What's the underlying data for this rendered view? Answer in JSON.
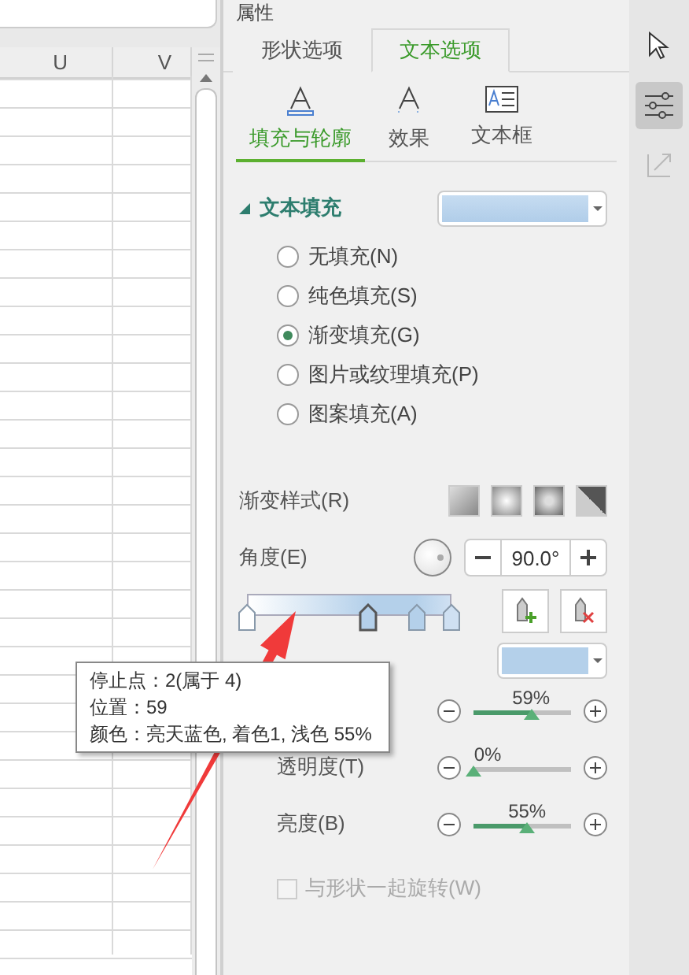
{
  "spreadsheet": {
    "columns": [
      "U",
      "V"
    ]
  },
  "panel": {
    "title": "属性",
    "tabs": [
      {
        "label": "形状选项",
        "selected": false
      },
      {
        "label": "文本选项",
        "selected": true
      }
    ],
    "subtabs": [
      {
        "kind": "fill",
        "label": "填充与轮廓",
        "selected": true
      },
      {
        "kind": "effect",
        "label": "效果",
        "selected": false
      },
      {
        "kind": "textbox",
        "label": "文本框",
        "selected": false
      }
    ],
    "text_fill": {
      "heading": "文本填充",
      "expanded": true,
      "options": [
        {
          "label": "无填充(N)",
          "selected": false
        },
        {
          "label": "纯色填充(S)",
          "selected": false
        },
        {
          "label": "渐变填充(G)",
          "selected": true
        },
        {
          "label": "图片或纹理填充(P)",
          "selected": false
        },
        {
          "label": "图案填充(A)",
          "selected": false
        }
      ],
      "gradient_style_label": "渐变样式(R)",
      "angle_label": "角度(E)",
      "angle_value": "90.0°",
      "stops": [
        {
          "level": 0,
          "color": "#ffffff",
          "selected": false
        },
        {
          "level": 0.59,
          "color": "#b4d0ea",
          "selected": true
        },
        {
          "level": 0.83,
          "color": "#b4d0ea",
          "selected": false
        },
        {
          "level": 1,
          "color": "#cfe0f2",
          "selected": false
        }
      ],
      "sliders": [
        {
          "reading": "59%",
          "level": 0.59
        },
        {
          "label": "透明度(T)",
          "reading": "0%",
          "level": 0
        },
        {
          "label": "亮度(B)",
          "reading": "55%",
          "level": 0.55
        }
      ],
      "rotate_with_shape": {
        "label": "与形状一起旋转(W)",
        "checked": false,
        "disabled": true
      }
    }
  },
  "tooltip": {
    "lines": [
      "停止点：2(属于 4)",
      "位置：59",
      "颜色：亮天蓝色, 着色1, 浅色 55%"
    ]
  },
  "toolbar": [
    {
      "kind": "cursor",
      "selected": false,
      "disabled": false
    },
    {
      "kind": "properties",
      "selected": true,
      "disabled": false
    },
    {
      "kind": "transform",
      "selected": false,
      "disabled": true
    }
  ]
}
